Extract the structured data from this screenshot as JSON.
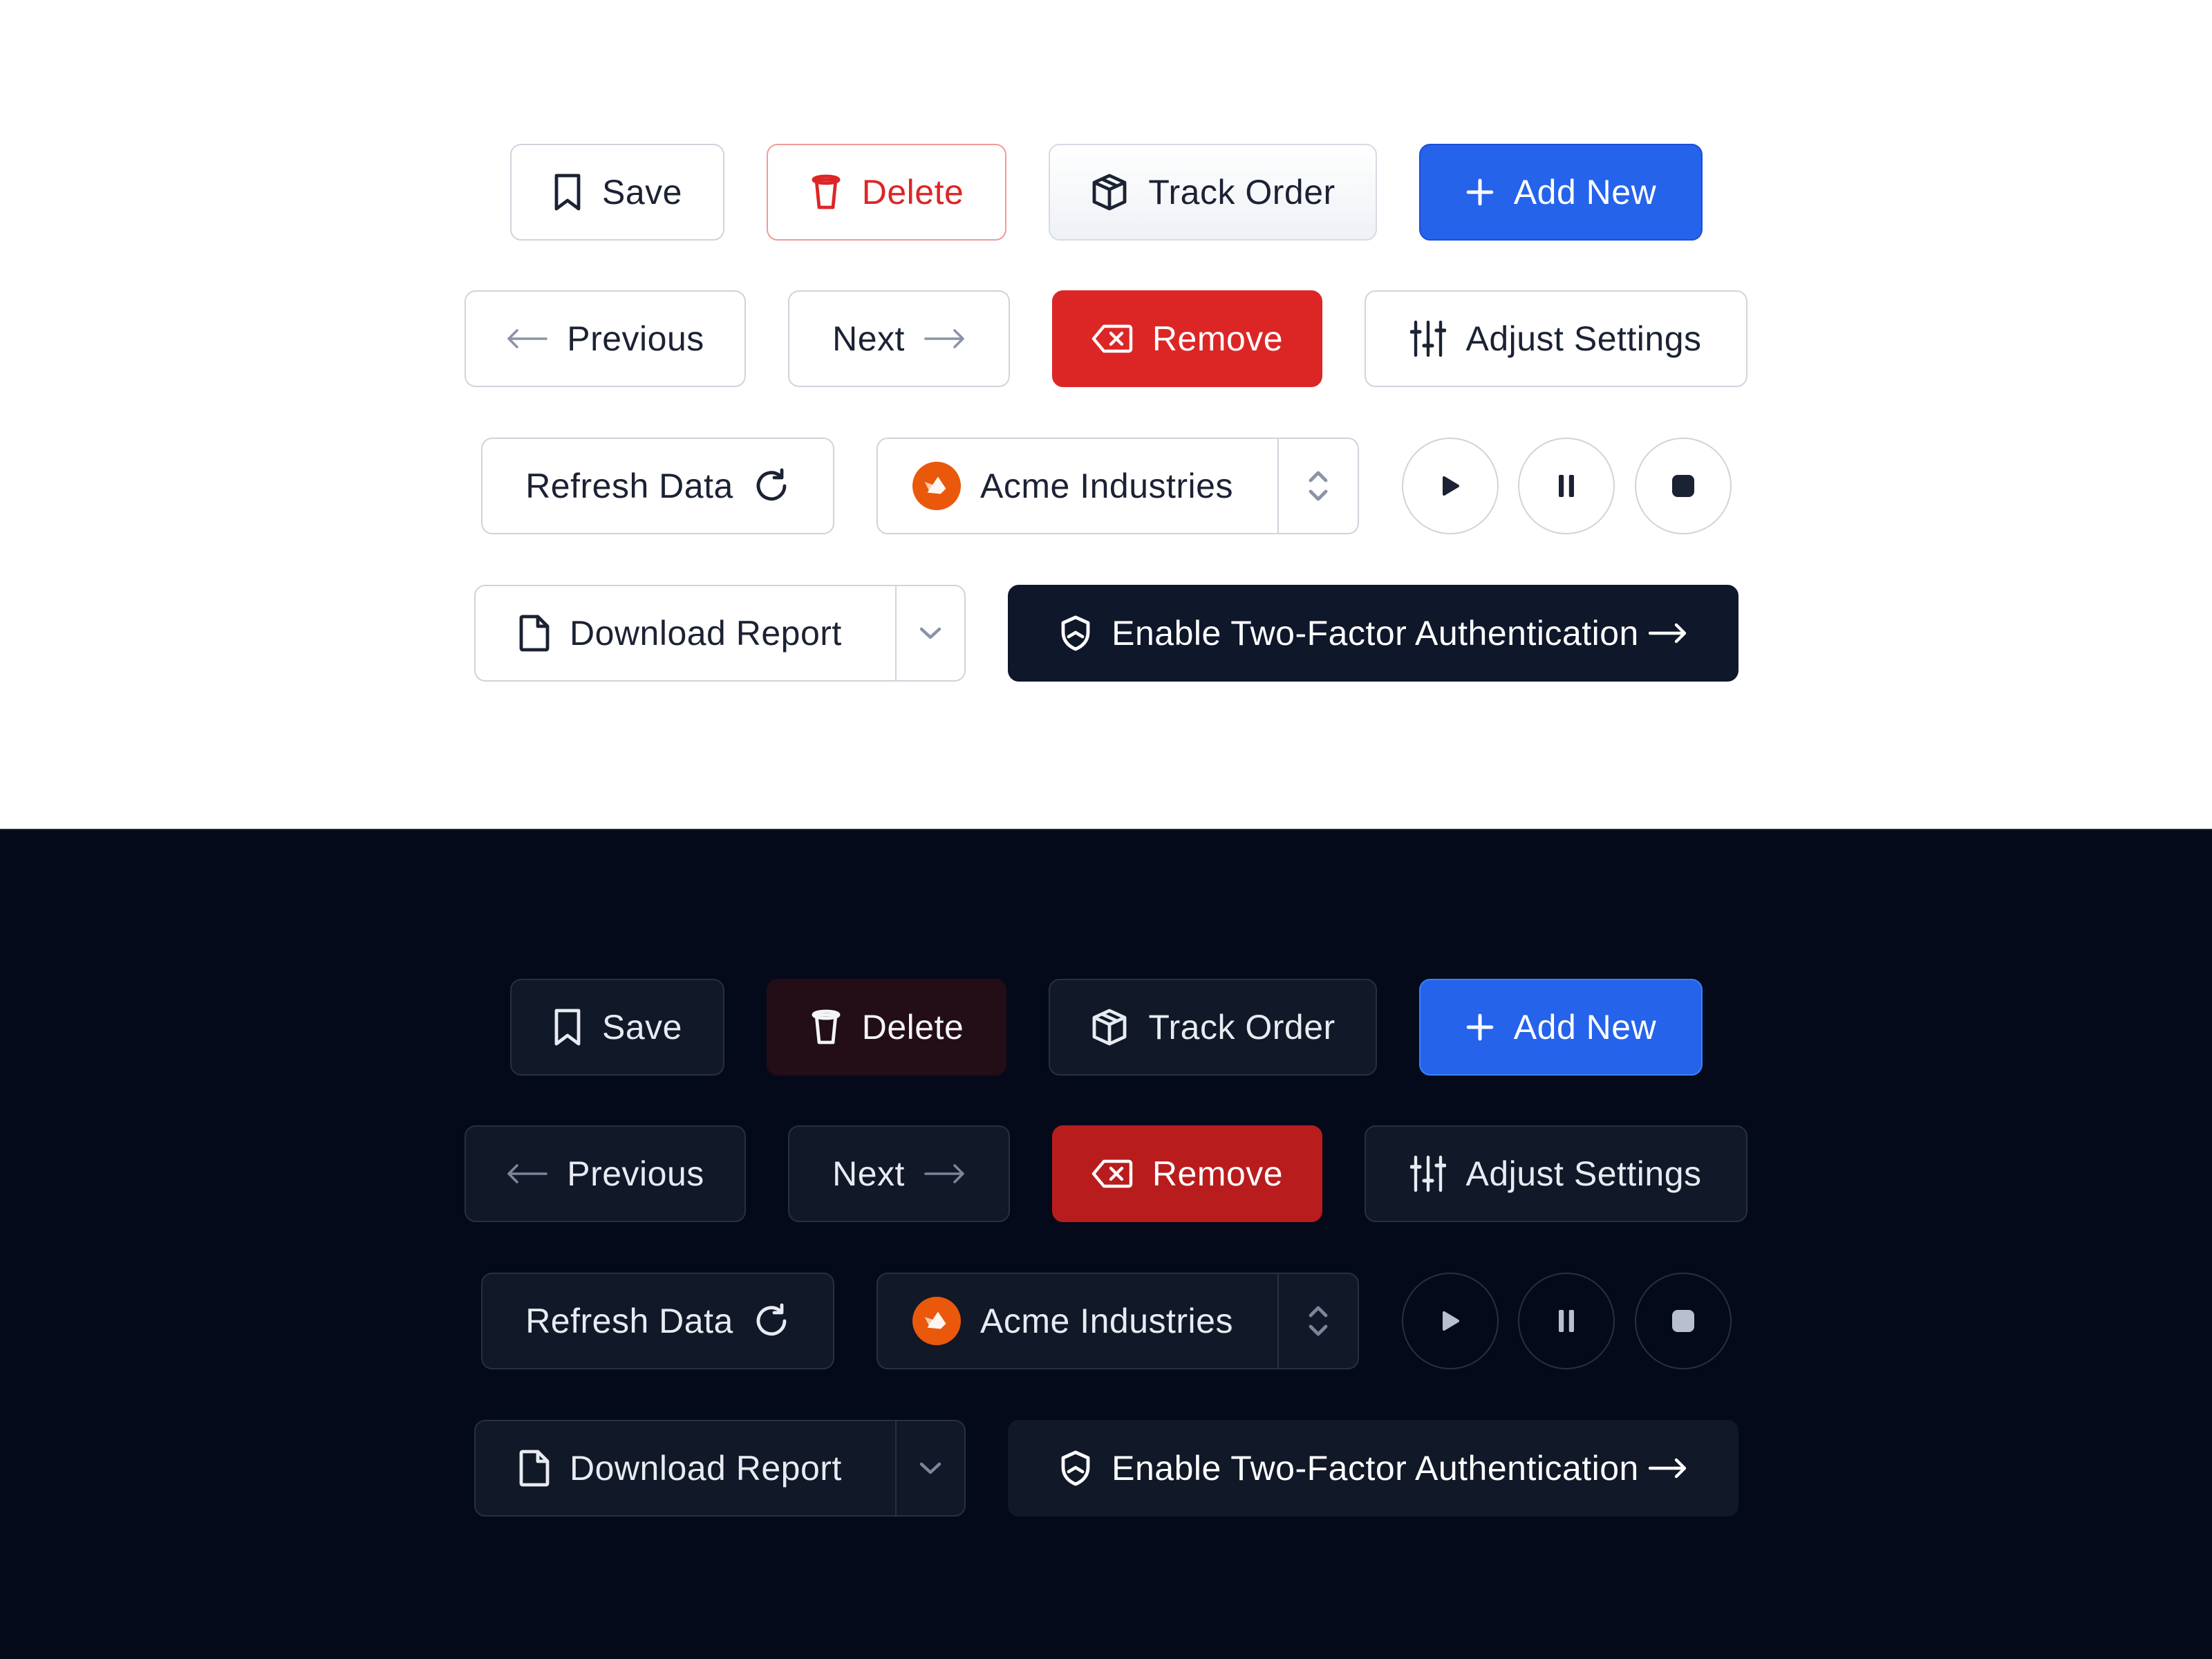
{
  "buttons": {
    "save": "Save",
    "delete": "Delete",
    "track_order": "Track Order",
    "add_new": "Add New",
    "previous": "Previous",
    "next": "Next",
    "remove": "Remove",
    "adjust_settings": "Adjust Settings",
    "refresh_data": "Refresh Data",
    "company_selector": "Acme Industries",
    "download_report": "Download Report",
    "enable_2fa": "Enable Two-Factor Authentication"
  },
  "media_controls": [
    "play-icon",
    "pause-icon",
    "stop-icon"
  ],
  "icons": {
    "save": "bookmark-icon",
    "delete": "trash-icon",
    "track_order": "package-icon",
    "add_new": "plus-icon",
    "previous": "arrow-left-icon",
    "next": "arrow-right-icon",
    "remove": "backspace-icon",
    "adjust_settings": "sliders-icon",
    "refresh_data": "refresh-icon",
    "company_selector": "chevron-up-down-icon",
    "download_report": "file-icon",
    "enable_2fa": "shield-icon"
  },
  "colors": {
    "primary": "#2563eb",
    "danger": "#dc2626",
    "dark_navy": "#0f172a",
    "avatar_orange": "#ea580c"
  },
  "themes": [
    "light",
    "dark"
  ]
}
